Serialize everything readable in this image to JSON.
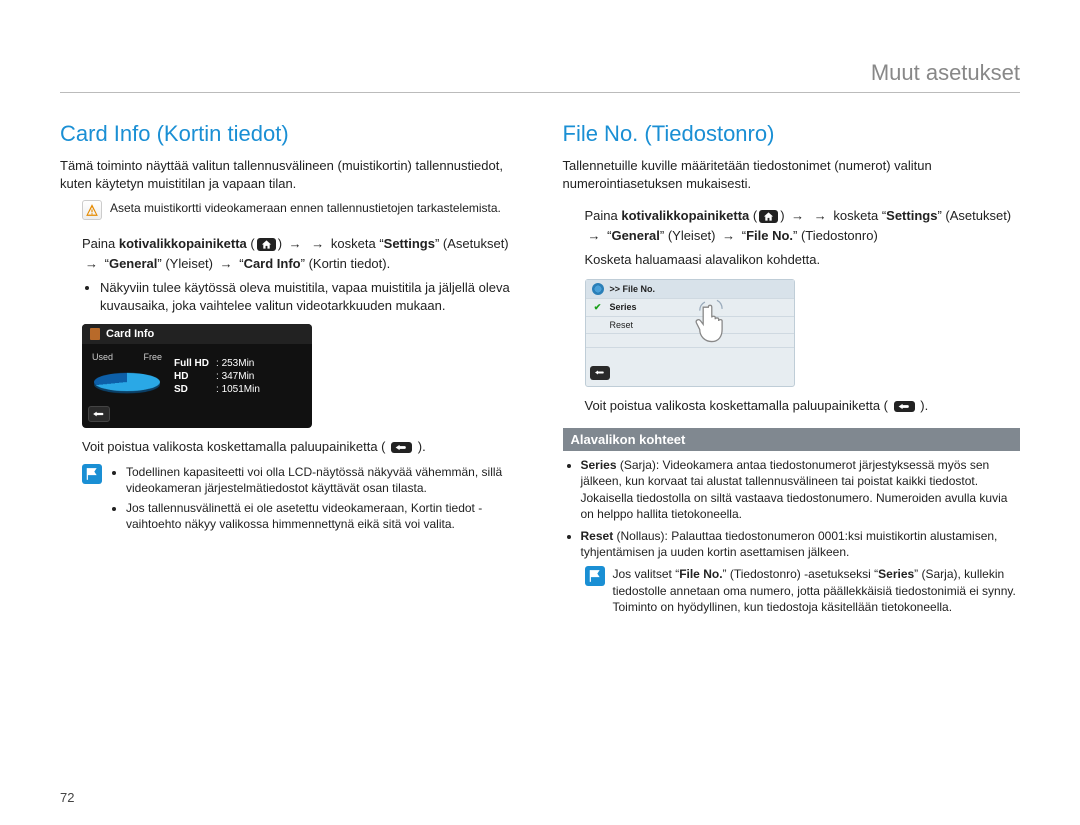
{
  "chapter_title": "Muut asetukset",
  "page_number": "72",
  "left": {
    "heading": "Card Info (Kortin tiedot)",
    "intro": "Tämä toiminto näyttää valitun tallennusvälineen (muistikortin) tallennustiedot, kuten käytetyn muistitilan ja vapaan tilan.",
    "warn_note": "Aseta muistikortti videokameraan ennen tallennustietojen tarkastelemista.",
    "nav": {
      "prefix": "Paina ",
      "home_label": "kotivalikkopainiketta",
      "after_home": "  kosketa “",
      "settings": "Settings",
      "after_settings": "” (Asetukset)  “",
      "general": "General",
      "after_general": "” (Yleiset)  “",
      "target": "Card Info",
      "after_target": "” (Kortin tiedot)."
    },
    "bullet": "Näkyviin tulee käytössä oleva muistitila, vapaa muistitila ja jäljellä oleva kuvausaika, joka vaihtelee valitun videotarkkuuden mukaan.",
    "lcd": {
      "title": "Card Info",
      "used": "Used",
      "free": "Free",
      "rows": [
        {
          "k": "Full HD",
          "v": "253Min"
        },
        {
          "k": "HD",
          "v": "347Min"
        },
        {
          "k": "SD",
          "v": "1051Min"
        }
      ]
    },
    "after_lcd": "Voit poistua valikosta koskettamalla paluupainiketta ( ",
    "after_lcd_end": " ).",
    "notes": [
      "Todellinen kapasiteetti voi olla LCD-näytössä näkyvää vähemmän, sillä videokameran järjestelmätiedostot käyttävät osan tilasta.",
      "Jos tallennusvälinettä ei ole asetettu videokameraan, Kortin tiedot -vaihtoehto näkyy valikossa himmennettynä eikä sitä voi valita."
    ]
  },
  "right": {
    "heading": "File No. (Tiedostonro)",
    "intro": "Tallennetuille kuville määritetään tiedostonimet (numerot) valitun numerointiasetuksen mukaisesti.",
    "nav": {
      "prefix": "Paina ",
      "home_label": "kotivalikkopainiketta",
      "after_home": "  kosketa “",
      "settings": "Settings",
      "after_settings": "” (Asetukset)  “",
      "general": "General",
      "after_general": "” (Yleiset)  “",
      "target": "File No.",
      "after_target": "” (Tiedostonro)"
    },
    "touch_line": "Kosketa haluamaasi alavalikon kohdetta.",
    "menu": {
      "crumb": ">> File No.",
      "opt1": "Series",
      "opt2": "Reset"
    },
    "after_lcd": "Voit poistua valikosta koskettamalla paluupainiketta ( ",
    "after_lcd_end": " ).",
    "sub_header": "Alavalikon kohteet",
    "sub_items": [
      {
        "label": "Series",
        "label_tr": " (Sarja): ",
        "text": "Videokamera antaa tiedostonumerot järjestyksessä myös sen jälkeen, kun korvaat tai alustat tallennusvälineen tai poistat kaikki tiedostot. Jokaisella tiedostolla on siltä vastaava tiedostonumero. Numeroiden avulla kuvia on helppo hallita tietokoneella."
      },
      {
        "label": "Reset",
        "label_tr": " (Nollaus): ",
        "text": "Palauttaa tiedostonumeron 0001:ksi muistikortin alustamisen, tyhjentämisen ja uuden kortin asettamisen jälkeen."
      }
    ],
    "note": {
      "pre": "Jos valitset “",
      "b1": "File No.",
      "mid1": "” (Tiedostonro) -asetukseksi “",
      "b2": "Series",
      "post": "” (Sarja), kullekin tiedostolle annetaan oma numero, jotta päällekkäisiä tiedostonimiä ei synny. Toiminto on hyödyllinen, kun tiedostoja käsitellään tietokoneella."
    }
  }
}
